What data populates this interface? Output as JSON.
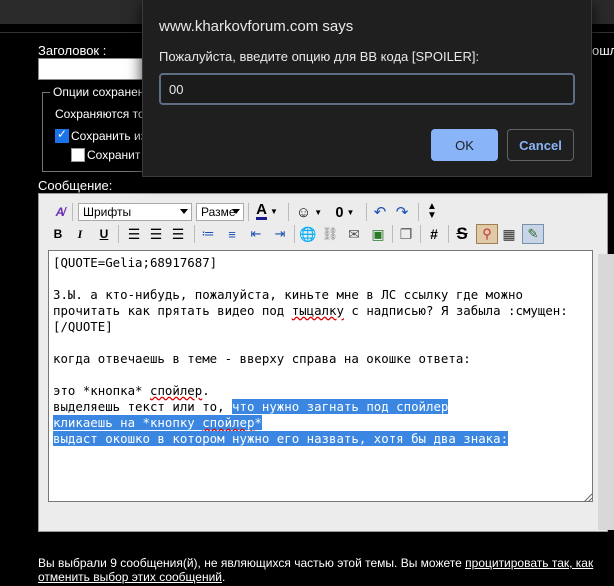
{
  "dialog": {
    "title": "www.kharkovforum.com says",
    "message": "Пожалуйста, введите опцию для BB кода [SPOILER]:",
    "input_value": "00",
    "ok_label": "OK",
    "cancel_label": "Cancel"
  },
  "form": {
    "title_label": "Заголовок :",
    "right_fragment": "ошл",
    "options_legend": "Опции сохранени",
    "saved_text": "Сохраняются то",
    "save_checkbox_label": "Сохранить из",
    "save_checkbox2_label": "Сохранит",
    "message_label": "Сообщение:",
    "save_checked": true,
    "save2_checked": false
  },
  "toolbar": {
    "font_select": "Шрифты",
    "size_select": "Разме",
    "icons": [
      "remove-format-icon",
      "font-color-icon",
      "smiley-icon",
      "attach-icon",
      "undo-icon",
      "redo-icon",
      "resize-arrows-icon",
      "bold-icon",
      "italic-icon",
      "underline-icon",
      "align-left-icon",
      "align-center-icon",
      "align-right-icon",
      "ordered-list-icon",
      "unordered-list-icon",
      "outdent-icon",
      "indent-icon",
      "link-icon",
      "unlink-icon",
      "email-link-icon",
      "image-icon",
      "quote-icon",
      "hash-icon",
      "strike-icon",
      "map-pin-icon",
      "table-icon",
      "brush-icon"
    ],
    "bold": "B",
    "italic": "I",
    "underline": "U",
    "hash": "#"
  },
  "editor": {
    "line1": "[QUOTE=Gelia;68917687]",
    "line3": "З.Ы. а кто-нибудь, пожалуйста, киньте мне в ЛС ссылку где можно",
    "line4a": "прочитать как прятать видео под ",
    "line4b": "тыцалку",
    "line4c": " с надписью? Я забыла :смущен:",
    "line5": "[/QUOTE]",
    "line7": "когда отвечаешь в теме - вверху справа на окошке ответа:",
    "line9a": "это *кнопка* ",
    "line9b": "спойлер",
    "line9c": ".",
    "line10a": "выделяешь текст или то, ",
    "line10b": "что нужно загнать под спойлер",
    "line11a": "кликаешь на *кнопку ",
    "line11b": "спойлер",
    "line11c": "*",
    "line12": "выдаст окошко в котором нужно его назвать, хотя бы два знака:"
  },
  "footer": {
    "line1_text": "Вы выбрали 9 сообщения(й), не являющихся частью этой темы. Вы можете ",
    "line1_link": "процитировать так, как",
    "line2_link": "отменить выбор этих сообщений",
    "line2_end": "."
  }
}
